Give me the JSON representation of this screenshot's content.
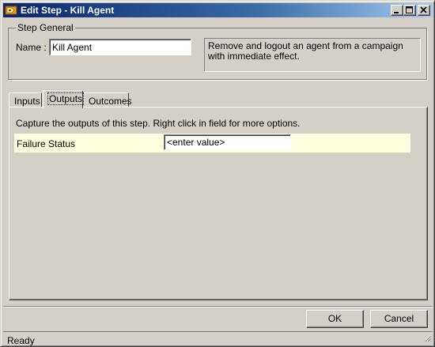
{
  "window": {
    "title": "Edit Step - Kill Agent"
  },
  "step_general": {
    "legend": "Step General",
    "name_label": "Name :",
    "name_value": "Kill Agent",
    "description": "Remove and logout an agent from a campaign with immediate effect."
  },
  "tabs": [
    {
      "label": "Inputs",
      "selected": false
    },
    {
      "label": "Outputs",
      "selected": true
    },
    {
      "label": "Outcomes",
      "selected": false
    }
  ],
  "outputs_panel": {
    "instructions": "Capture the outputs of this step.  Right click in field for more options.",
    "rows": [
      {
        "name": "Failure Status",
        "value": "<enter value>"
      }
    ]
  },
  "buttons": {
    "ok": "OK",
    "cancel": "Cancel"
  },
  "status": {
    "text": "Ready"
  },
  "colors": {
    "title_gradient_start": "#0a246a",
    "title_gradient_end": "#a6caf0",
    "window_face": "#d4d0c8",
    "output_row_bg": "#ffffe0"
  }
}
